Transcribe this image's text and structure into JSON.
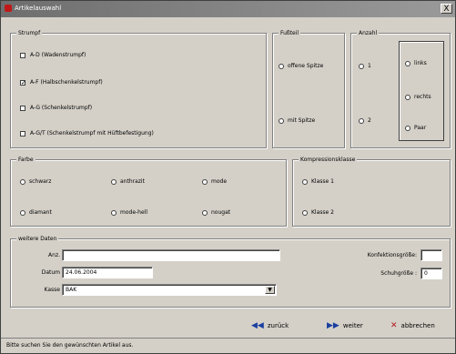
{
  "window": {
    "title": "Artikelauswahl",
    "close_label": "X"
  },
  "groups": {
    "strumpf": {
      "title": "Strumpf",
      "items": [
        {
          "label": "A-D (Wadenstrumpf)",
          "checked": false
        },
        {
          "label": "A-F (Halbschenkelstrumpf)",
          "checked": true
        },
        {
          "label": "A-G (Schenkelstrumpf)",
          "checked": false
        },
        {
          "label": "A-G/T (Schenkelstrumpf mit Hüftbefestigung)",
          "checked": false
        }
      ]
    },
    "fussteil": {
      "title": "Fußteil",
      "items": [
        {
          "label": "offene Spitze"
        },
        {
          "label": "mit Spitze"
        }
      ]
    },
    "anzahl": {
      "title": "Anzahl",
      "items": [
        {
          "label": "1"
        },
        {
          "label": "2"
        }
      ],
      "side_items": [
        {
          "label": "links"
        },
        {
          "label": "rechts"
        },
        {
          "label": "Paar"
        }
      ]
    },
    "farbe": {
      "title": "Farbe",
      "items": [
        {
          "label": "schwarz"
        },
        {
          "label": "anthrazit"
        },
        {
          "label": "mode"
        },
        {
          "label": "diamant"
        },
        {
          "label": "mode-hell"
        },
        {
          "label": "nougat"
        }
      ]
    },
    "kompression": {
      "title": "Kompressionsklasse",
      "items": [
        {
          "label": "Klasse 1"
        },
        {
          "label": "Klasse 2"
        }
      ]
    },
    "weitere": {
      "title": "weitere Daten",
      "anzahl_label": "Anz.",
      "anzahl_value": "",
      "datum_label": "Datum",
      "datum_value": "24.06.2004",
      "kasse_label": "Kasse",
      "kasse_value": "BAK",
      "konfektion_label": "Konfektionsgröße:",
      "konfektion_value": "",
      "schuh_label": "Schuhgröße :",
      "schuh_value": "0"
    }
  },
  "buttons": {
    "back_label": "zurück",
    "next_label": "weiter",
    "cancel_label": "abbrechen",
    "back_icon": "rewind-icon",
    "next_icon": "fast-forward-icon",
    "cancel_icon": "x-icon"
  },
  "status": {
    "text": "Bitte suchen Sie den gewünschten Artikel aus."
  }
}
